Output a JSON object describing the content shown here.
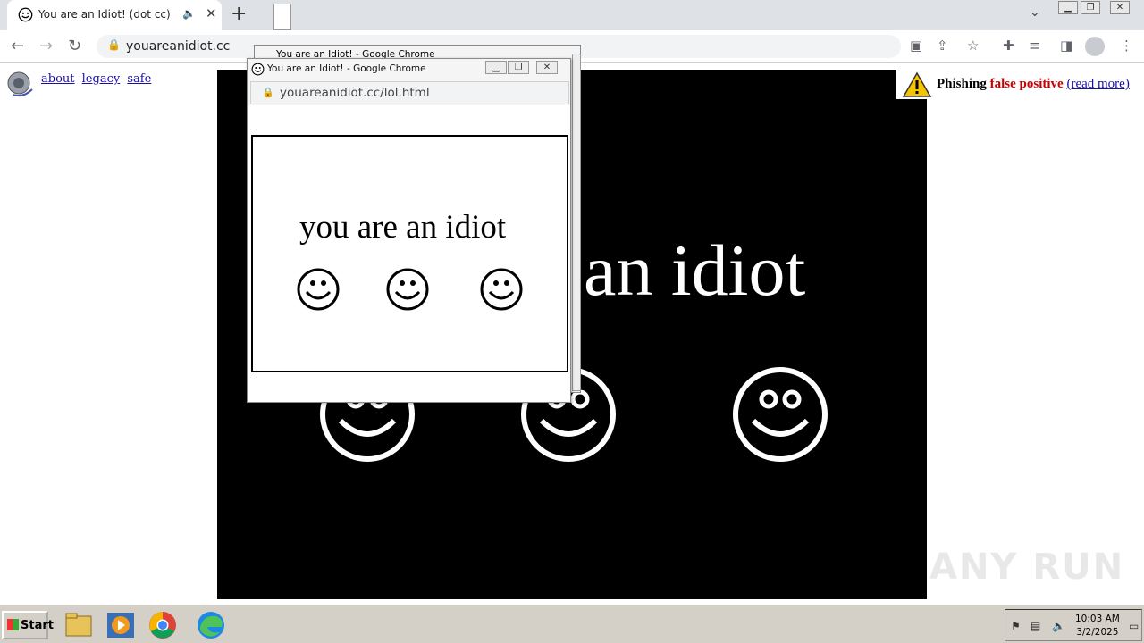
{
  "browser": {
    "tab_title": "You are an Idiot! (dot cc)",
    "url": "youareanidiot.cc"
  },
  "page": {
    "top_links": [
      "about",
      "legacy",
      "safe"
    ],
    "big_text": "an idiot",
    "phishing_banner": {
      "prefix": "Phishing",
      "highlight": "false positive",
      "link": "(read more)"
    }
  },
  "popup": {
    "title": "You are an Idiot! - Google Chrome",
    "url": "youareanidiot.cc/lol.html",
    "text": "you are an idiot",
    "behind_title": "You are an Idiot! - Google Chrome"
  },
  "watermark": "ANY RUN",
  "taskbar": {
    "start_label": "Start",
    "clock_time": "10:03 AM",
    "clock_date": "3/2/2025"
  },
  "colors": {
    "stage_bg": "#000000",
    "warning_red": "#cc0000",
    "link_blue": "#1a0dab"
  }
}
